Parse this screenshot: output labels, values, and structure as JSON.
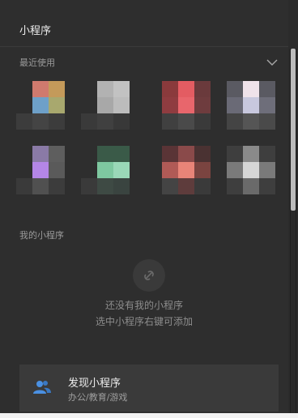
{
  "header": {
    "title": "小程序"
  },
  "recent": {
    "label": "最近使用",
    "collapse_icon": "chevron-down-icon"
  },
  "recent_apps": [
    {
      "accent": "#c27a6e"
    },
    {
      "accent": "#bcbcbc"
    },
    {
      "accent": "#e35c62"
    },
    {
      "accent": "#d7d3e6"
    },
    {
      "accent": "#b486e6"
    },
    {
      "accent": "#8fd6b0"
    },
    {
      "accent": "#e37a6e"
    },
    {
      "accent": "#cfcfcf"
    }
  ],
  "mine": {
    "label": "我的小程序",
    "empty_icon": "mini-program-link-icon",
    "empty_line1": "还没有我的小程序",
    "empty_line2": "选中小程序右键可添加"
  },
  "discover": {
    "title": "发现小程序",
    "subtitle": "办公/教育/游戏",
    "icon": "users-icon",
    "icon_color": "#4a90e2"
  }
}
